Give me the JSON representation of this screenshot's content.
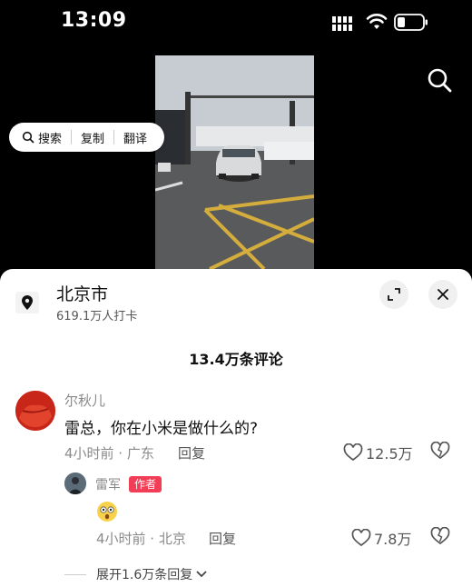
{
  "status_bar": {
    "time": "13:09"
  },
  "context_menu": {
    "search": "搜索",
    "copy": "复制",
    "translate": "翻译"
  },
  "location": {
    "name": "北京市",
    "checkins": "619.1万人打卡"
  },
  "comments_header": {
    "count": "13.4万条评论"
  },
  "comment": {
    "author": "尔秋儿",
    "text": "雷总，你在小米是做什么的?",
    "meta": "4小时前 · 广东",
    "reply_label": "回复",
    "likes": "12.5万"
  },
  "reply": {
    "author": "雷军",
    "badge": "作者",
    "meta": "4小时前 · 北京",
    "reply_label": "回复",
    "likes": "7.8万"
  },
  "expand": {
    "label": "展开1.6万条回复"
  },
  "colors": {
    "author_badge": "#f23d56",
    "sheet_bg": "#ffffff",
    "app_bg": "#000000"
  }
}
